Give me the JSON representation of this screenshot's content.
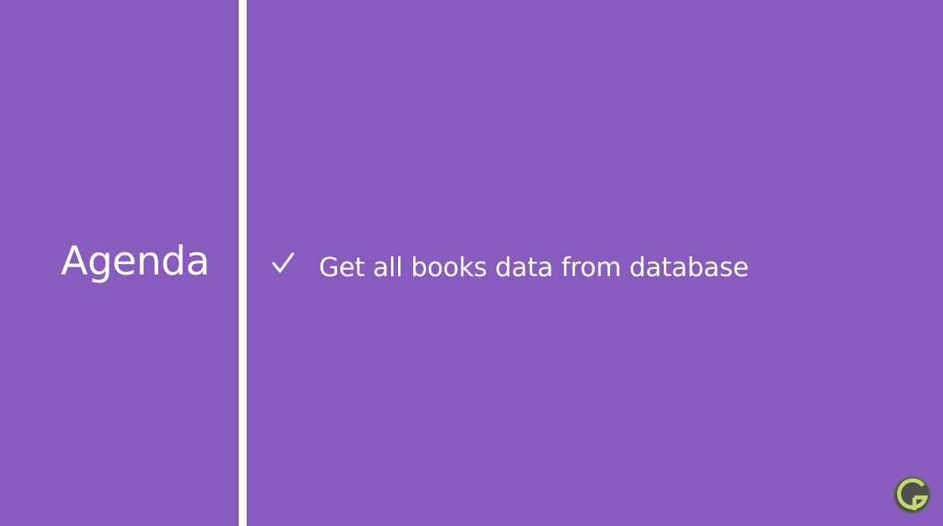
{
  "slide": {
    "background_color": "#885bbf",
    "divider_color": "#ffffff",
    "title": "Agenda",
    "agenda_items": [
      {
        "icon": "check-icon",
        "text": "Get all books data from database"
      }
    ],
    "logo": {
      "icon": "g-logo-icon",
      "ring_color": "#c7d86a",
      "inner_color": "#5a5a5a"
    }
  }
}
